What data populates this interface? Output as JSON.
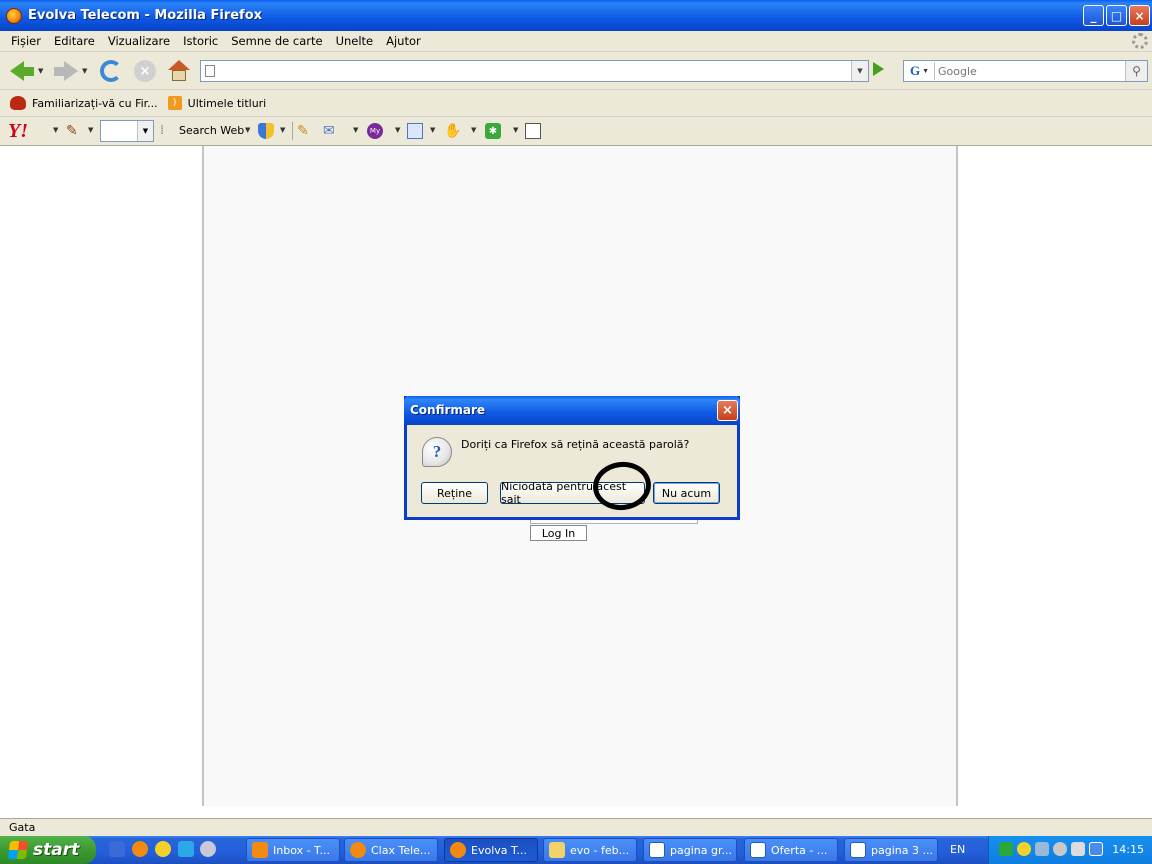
{
  "window": {
    "title": "Evolva Telecom - Mozilla Firefox",
    "buttons": {
      "minimize": "_",
      "maximize": "□",
      "close": "×"
    }
  },
  "menu": [
    "Fișier",
    "Editare",
    "Vizualizare",
    "Istoric",
    "Semne de carte",
    "Unelte",
    "Ajutor"
  ],
  "navigation": {
    "url_value": "",
    "search_placeholder": "Google",
    "search_engine_label": "G"
  },
  "bookmarks": [
    {
      "label": "Familiarizați-vă cu Fir...",
      "icon": "firefox-icon"
    },
    {
      "label": "Ultimele titluri",
      "icon": "rss-icon"
    }
  ],
  "yahoo_toolbar": {
    "logo": "Y!",
    "search_label": "Search Web"
  },
  "page": {
    "login_button": "Log In"
  },
  "dialog": {
    "title": "Confirmare",
    "question": "Doriți ca Firefox să rețină această parolă?",
    "buttons": [
      "Reține",
      "Niciodată pentru acest sait",
      "Nu acum"
    ],
    "close": "×"
  },
  "status": {
    "text": "Gata"
  },
  "taskbar": {
    "start_label": "start",
    "tasks": [
      "Inbox - T...",
      "Clax Tele...",
      "Evolva T...",
      "evo - feb...",
      "pagina gr...",
      "Oferta - ...",
      "pagina 3 ..."
    ],
    "active_task_index": 2,
    "language": "EN",
    "clock": "14:15"
  },
  "colors": {
    "titlebar_blue": "#0e58e3",
    "dialog_border": "#0a3ec8",
    "close_red": "#c4401c",
    "start_green": "#3c9a30",
    "yahoo_red": "#d1001c"
  }
}
